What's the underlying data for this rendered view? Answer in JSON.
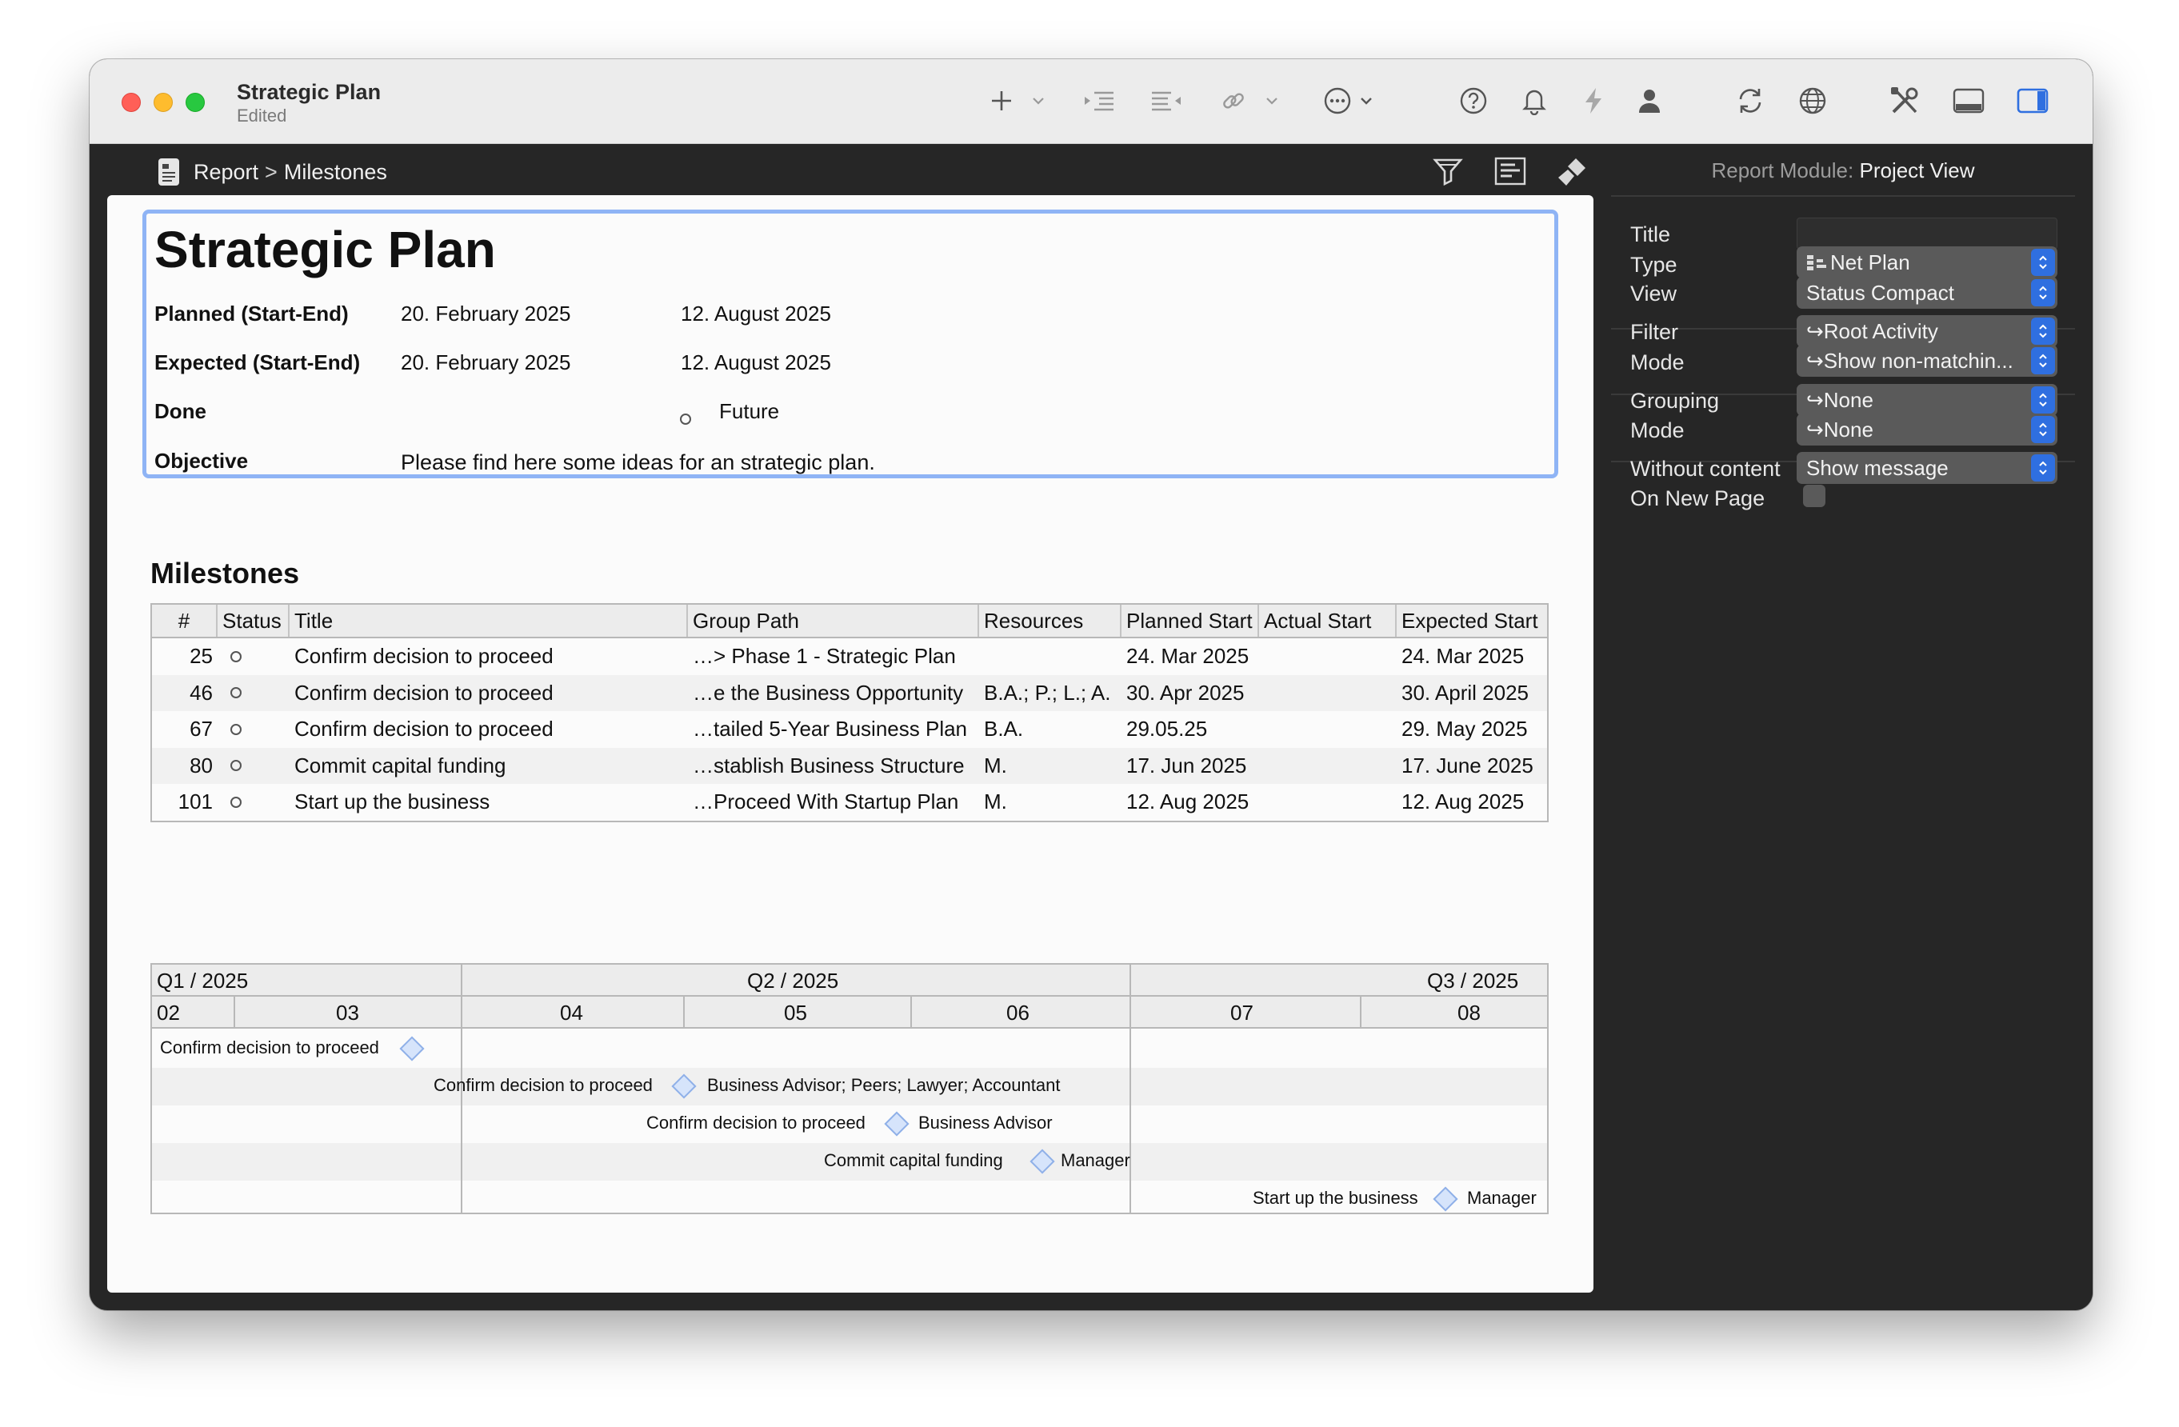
{
  "window": {
    "title": "Strategic Plan",
    "subtitle": "Edited"
  },
  "toolbar": {
    "icons": [
      "plus-icon",
      "indent-icon",
      "list-outdent-icon",
      "link-icon",
      "more-icon",
      "help-icon",
      "bell-icon",
      "lightning-icon",
      "person-icon",
      "sync-icon",
      "globe-icon",
      "tools-icon",
      "bottom-panel-icon",
      "sidebar-icon"
    ]
  },
  "breadcrumb": {
    "root": "Report",
    "separator": ">",
    "current": "Milestones"
  },
  "report": {
    "title": "Strategic Plan",
    "rows": {
      "planned_label": "Planned (Start-End)",
      "planned_start": "20. February 2025",
      "planned_end": "12. August 2025",
      "expected_label": "Expected (Start-End)",
      "expected_start": "20. February 2025",
      "expected_end": "12. August 2025",
      "done_label": "Done",
      "done_value": "Future",
      "objective_label": "Objective",
      "objective_value": "Please find here some ideas for an strategic plan."
    }
  },
  "milestones": {
    "title": "Milestones",
    "columns": [
      "#",
      "Status",
      "Title",
      "Group Path",
      "Resources",
      "Planned Start",
      "Actual Start",
      "Expected Start"
    ],
    "rows": [
      {
        "num": "25",
        "title": "Confirm decision to proceed",
        "path": "…> Phase 1 - Strategic Plan",
        "resources": "",
        "planned": "24. Mar 2025",
        "actual": "",
        "expected": "24. Mar 2025"
      },
      {
        "num": "46",
        "title": "Confirm decision to proceed",
        "path": "…e the Business Opportunity",
        "resources": "B.A.; P.; L.; A.",
        "planned": "30. Apr 2025",
        "actual": "",
        "expected": "30. April 2025"
      },
      {
        "num": "67",
        "title": "Confirm decision to proceed",
        "path": "…tailed 5-Year Business Plan",
        "resources": "B.A.",
        "planned": "29.05.25",
        "actual": "",
        "expected": "29. May 2025"
      },
      {
        "num": "80",
        "title": "Commit capital funding",
        "path": "…stablish Business Structure",
        "resources": "M.",
        "planned": "17. Jun 2025",
        "actual": "",
        "expected": "17. June 2025"
      },
      {
        "num": "101",
        "title": "Start up the business",
        "path": "…Proceed With Startup Plan",
        "resources": "M.",
        "planned": "12. Aug 2025",
        "actual": "",
        "expected": "12. Aug 2025"
      }
    ]
  },
  "gantt": {
    "quarters": [
      "Q1 / 2025",
      "Q2 / 2025",
      "Q3 / 2025"
    ],
    "months": [
      "02",
      "03",
      "04",
      "05",
      "06",
      "07",
      "08"
    ],
    "items": [
      {
        "label": "Confirm decision to proceed",
        "resource": ""
      },
      {
        "label": "Confirm decision to proceed",
        "resource": "Business Advisor; Peers; Lawyer; Accountant"
      },
      {
        "label": "Confirm decision to proceed",
        "resource": "Business Advisor"
      },
      {
        "label": "Commit capital funding",
        "resource": "Manager"
      },
      {
        "label": "Start up the business",
        "resource": "Manager"
      }
    ]
  },
  "inspector": {
    "header_prefix": "Report Module:",
    "header_value": "Project View",
    "title_label": "Title",
    "title_value": "",
    "type_label": "Type",
    "type_value": "Net Plan",
    "view_label": "View",
    "view_value": "Status Compact",
    "filter_label": "Filter",
    "filter_value": "↪Root Activity",
    "filter_mode_label": "Mode",
    "filter_mode_value": "↪Show non-matchin...",
    "grouping_label": "Grouping",
    "grouping_value": "↪None",
    "grouping_mode_label": "Mode",
    "grouping_mode_value": "↪None",
    "without_content_label": "Without content",
    "without_content_value": "Show message",
    "new_page_label": "On New Page",
    "new_page_checked": false
  },
  "colors": {
    "accent_blue": "#2f6fe0",
    "selection_border": "#8fb4f5",
    "milestone_fill": "#d6e4fb"
  }
}
